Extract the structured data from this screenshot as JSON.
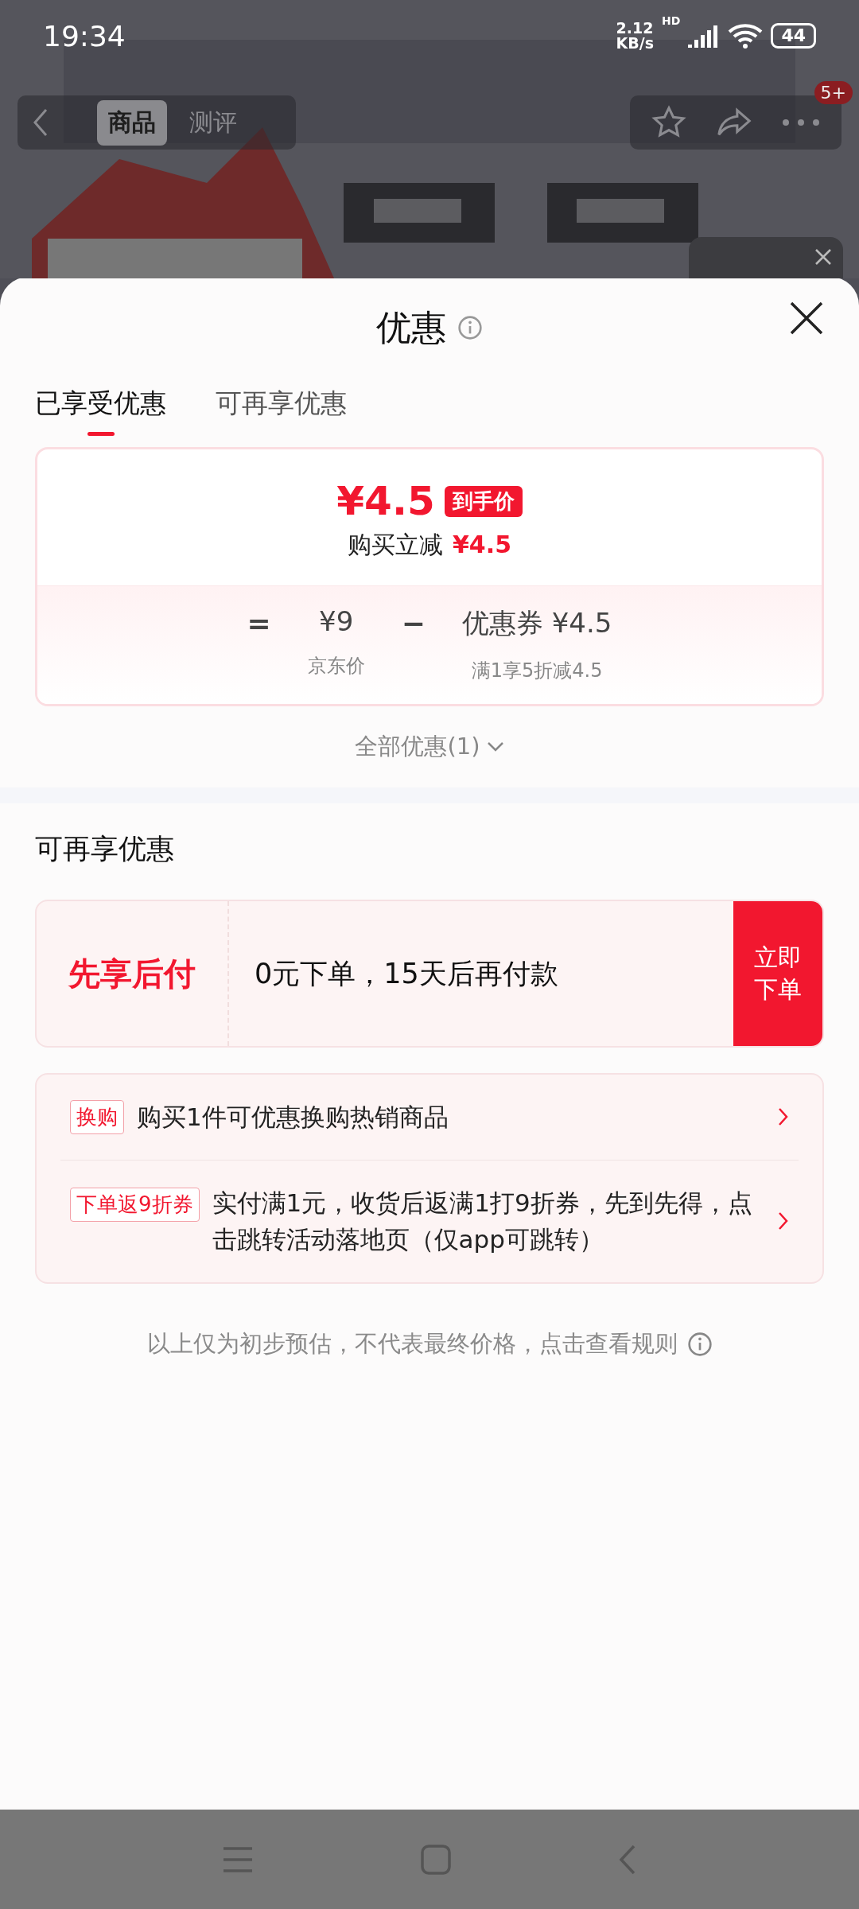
{
  "status_bar": {
    "time": "19:34",
    "speed_value": "2.12",
    "speed_unit": "KB/s",
    "network_label": "HD",
    "battery": "44"
  },
  "nav": {
    "tabs": [
      {
        "label": "商品",
        "selected": true
      },
      {
        "label": "测评",
        "selected": false
      }
    ],
    "badge": "5+"
  },
  "sheet": {
    "title": "优惠",
    "tabs": [
      {
        "label": "已享受优惠",
        "selected": true
      },
      {
        "label": "可再享优惠",
        "selected": false
      }
    ],
    "summary": {
      "price": "¥4.5",
      "price_tag": "到手价",
      "discount_label": "购买立减",
      "discount_amount": "¥4.5",
      "breakdown": [
        {
          "kind": "operator",
          "symbol": "="
        },
        {
          "kind": "term",
          "value": "¥9",
          "caption": "京东价"
        },
        {
          "kind": "operator",
          "symbol": "−"
        },
        {
          "kind": "term",
          "value": "优惠券 ¥4.5",
          "caption": "满1享5折减4.5"
        }
      ]
    },
    "all_offers": "全部优惠(1)",
    "more": {
      "title": "可再享优惠",
      "pay_later": {
        "label": "先享后付",
        "text": "0元下单，15天后再付款",
        "button": "立即下单"
      },
      "promotions": [
        {
          "tag": "换购",
          "text": "购买1件可优惠换购热销商品"
        },
        {
          "tag": "下单返9折券",
          "text": "实付满1元，收货后返满1打9折券，先到先得，点击跳转活动落地页（仅app可跳转）"
        }
      ]
    },
    "note": "以上仅为初步预估，不代表最终价格，点击查看规则"
  }
}
